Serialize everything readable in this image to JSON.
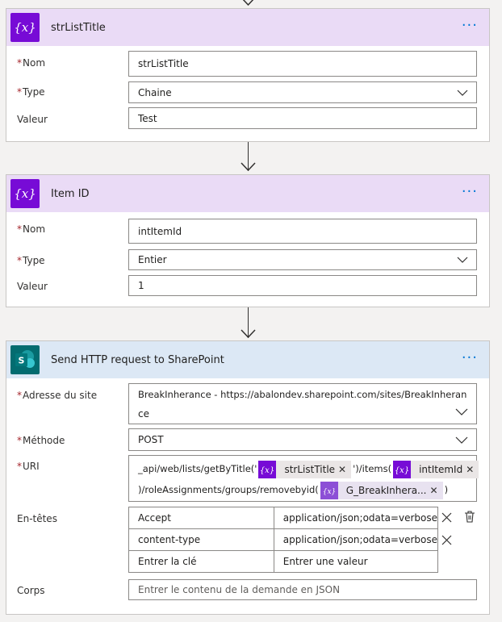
{
  "card1": {
    "title": "strListTitle",
    "labels": {
      "nom": "Nom",
      "type": "Type",
      "valeur": "Valeur"
    },
    "fields": {
      "nom": "strListTitle",
      "type": "Chaine",
      "valeur": "Test"
    }
  },
  "card2": {
    "title": "Item ID",
    "labels": {
      "nom": "Nom",
      "type": "Type",
      "valeur": "Valeur"
    },
    "fields": {
      "nom": "intItemId",
      "type": "Entier",
      "valeur": "1"
    }
  },
  "card3": {
    "title": "Send HTTP request to SharePoint",
    "labels": {
      "site": "Adresse du site",
      "methode": "Méthode",
      "uri": "URI",
      "entetes": "En-têtes",
      "corps": "Corps"
    },
    "site_line1": "BreakInherance - https://abalondev.sharepoint.com/sites/BreakInheran",
    "site_line2": "ce",
    "methode": "POST",
    "uri": {
      "part1": "_api/web/lists/getByTitle('",
      "token1": "strListTitle",
      "part2": "')/items(",
      "token2": "intItemId",
      "part3": ")/roleAssignments/groups/removebyid(",
      "token3": "G_BreakInhera...",
      "part4": ")"
    },
    "headers": [
      {
        "key": "Accept",
        "value": "application/json;odata=verbose"
      },
      {
        "key": "content-type",
        "value": "application/json;odata=verbose"
      }
    ],
    "header_key_placeholder": "Entrer la clé",
    "header_value_placeholder": "Entrer une valeur",
    "corps_placeholder": "Entrer le contenu de la demande en JSON"
  },
  "icons": {
    "variable": "variable-icon",
    "sharepoint": "sharepoint-icon",
    "more": "more-options-icon",
    "chevron": "chevron-down-icon",
    "close": "close-icon",
    "delete": "delete-icon"
  },
  "colors": {
    "variable_accent": "#770bd6",
    "variable_header": "#eadbf6",
    "sharepoint_accent": "#036c70",
    "sharepoint_header": "#dce8f5",
    "link": "#0078d4",
    "required": "#a4262c"
  }
}
